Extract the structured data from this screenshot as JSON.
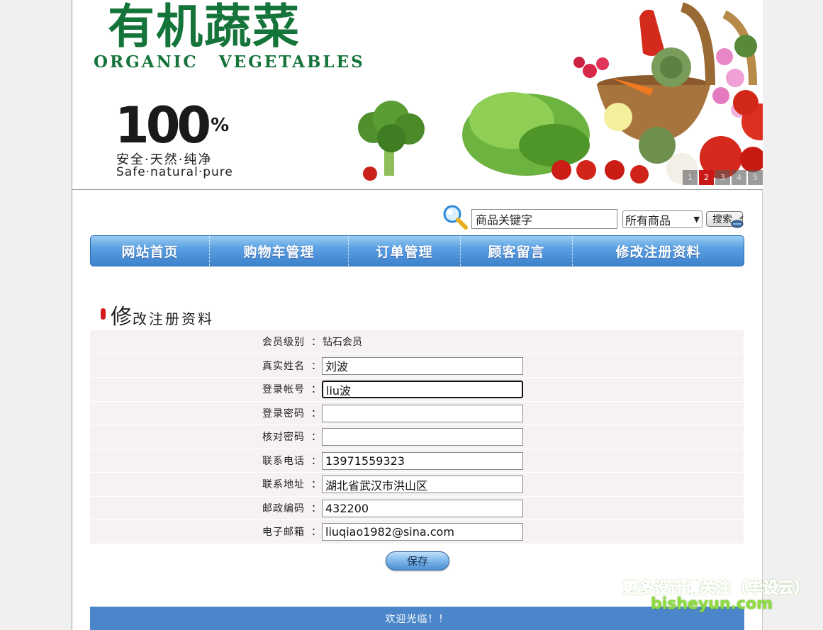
{
  "banner": {
    "logo_cn": "有机蔬菜",
    "logo_en": "ORGANIC VEGETABLES",
    "hundred": "100",
    "percent": "%",
    "slogan_cn": "安全·天然·纯净",
    "slogan_en": "Safe·natural·pure",
    "slides": [
      "1",
      "2",
      "3",
      "4",
      "5"
    ],
    "active_slide": "2"
  },
  "search": {
    "keyword_value": "商品关键字",
    "category_selected": "所有商品",
    "button_label": "搜索"
  },
  "nav": {
    "items": [
      "网站首页",
      "购物车管理",
      "订单管理",
      "顾客留言",
      "修改注册资料"
    ]
  },
  "section": {
    "title_first": "修",
    "title_rest": "改注册资料"
  },
  "form": {
    "colon": "：",
    "member_level_label": "会员级别",
    "member_level_value": "钻石会员",
    "fields": [
      {
        "label": "真实姓名",
        "value": "刘波"
      },
      {
        "label": "登录帐号",
        "value": "liu波"
      },
      {
        "label": "登录密码",
        "value": ""
      },
      {
        "label": "核对密码",
        "value": ""
      },
      {
        "label": "联系电话",
        "value": "13971559323"
      },
      {
        "label": "联系地址",
        "value": "湖北省武汉市洪山区"
      },
      {
        "label": "邮政编码",
        "value": "432200"
      },
      {
        "label": "电子邮箱",
        "value": "liuqiao1982@sina.com"
      }
    ],
    "save_label": "保存"
  },
  "footer": {
    "text": "欢迎光临！！"
  },
  "watermark": {
    "line1": "更多设计请关注（毕设云）",
    "line2": "bisheyun.com"
  },
  "colors": {
    "brand_green": "#14743a",
    "nav_blue": "#3d82cc",
    "footer_blue": "#4a86c9",
    "accent_red": "#d31919"
  }
}
